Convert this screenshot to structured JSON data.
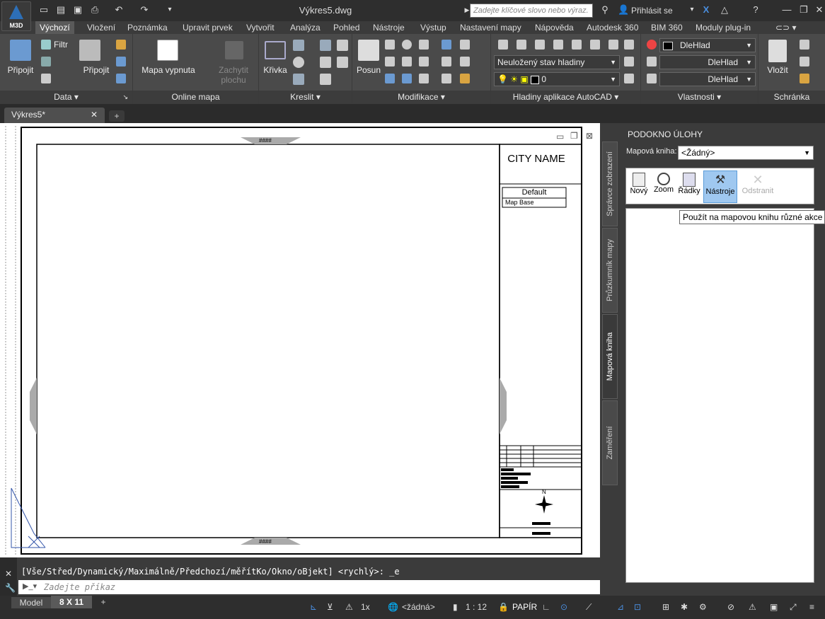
{
  "app": {
    "badge": "M3D",
    "document_title": "Výkres5.dwg"
  },
  "qat": {
    "new": "new-icon",
    "open": "open-icon",
    "save": "save-icon",
    "print": "print-icon",
    "undo": "undo-icon",
    "redo": "redo-icon"
  },
  "search": {
    "placeholder": "Zadejte klíčové slovo nebo výraz."
  },
  "signin": {
    "label": "Přihlásit se"
  },
  "ribbon_tabs": [
    "Výchozí",
    "Vložení",
    "Poznámka",
    "Upravit prvek",
    "Vytvořit",
    "Analýza",
    "Pohled",
    "Nástroje",
    "Výstup",
    "Nastavení mapy",
    "Nápověda",
    "Autodesk 360",
    "BIM 360",
    "Moduly plug-in"
  ],
  "panels": {
    "data": {
      "title": "Data",
      "pripojit": "Připojit",
      "filtr": "Filtr"
    },
    "pripojit": {
      "label": "Připojit"
    },
    "online": {
      "title": "Online mapa",
      "mapa": "Mapa vypnuta",
      "zachytit": "Zachytit plochu"
    },
    "kreslit": {
      "title": "Kreslit",
      "krivka": "Křivka"
    },
    "modifikace": {
      "title": "Modifikace",
      "posun": "Posun"
    },
    "hladiny": {
      "title": "Hladiny aplikace AutoCAD",
      "state": "Neuložený stav hladiny",
      "layer": "0"
    },
    "vlastnosti": {
      "title": "Vlastnosti",
      "color": "DleHlad",
      "linetype": "DleHlad",
      "lineweight": "DleHlad"
    },
    "schranka": {
      "title": "Schránka",
      "vlozit": "Vložit"
    }
  },
  "file_tab": {
    "label": "Výkres5*"
  },
  "drawing": {
    "city_name": "CITY NAME",
    "legend_title": "Default",
    "legend_item": "Map Base",
    "nav_label": "####",
    "north": "N"
  },
  "palette_tabs": [
    "Správce zobrazení",
    "Průzkumník mapy",
    "Mapová kniha",
    "Zaměření"
  ],
  "taskpane": {
    "title": "PODOKNO ÚLOHY",
    "mapbook_label": "Mapová kniha:",
    "mapbook_value": "<Žádný>",
    "tools": [
      "Nový",
      "Zoom",
      "Řádky",
      "Nástroje",
      "Odstranit"
    ],
    "tooltip": "Použít na mapovou knihu různé akce"
  },
  "command": {
    "history": "[Vše/Střed/Dynamický/Maximálně/Předchozí/měřítKo/Okno/oBjekt] <rychlý>: _e",
    "placeholder": "Zadejte příkaz"
  },
  "status": {
    "model_tab": "Model",
    "layout_tab": "8 X 11",
    "scale_mult": "1x",
    "coordsys": "<žádná>",
    "scale": "1 : 12",
    "space": "PAPÍR"
  }
}
